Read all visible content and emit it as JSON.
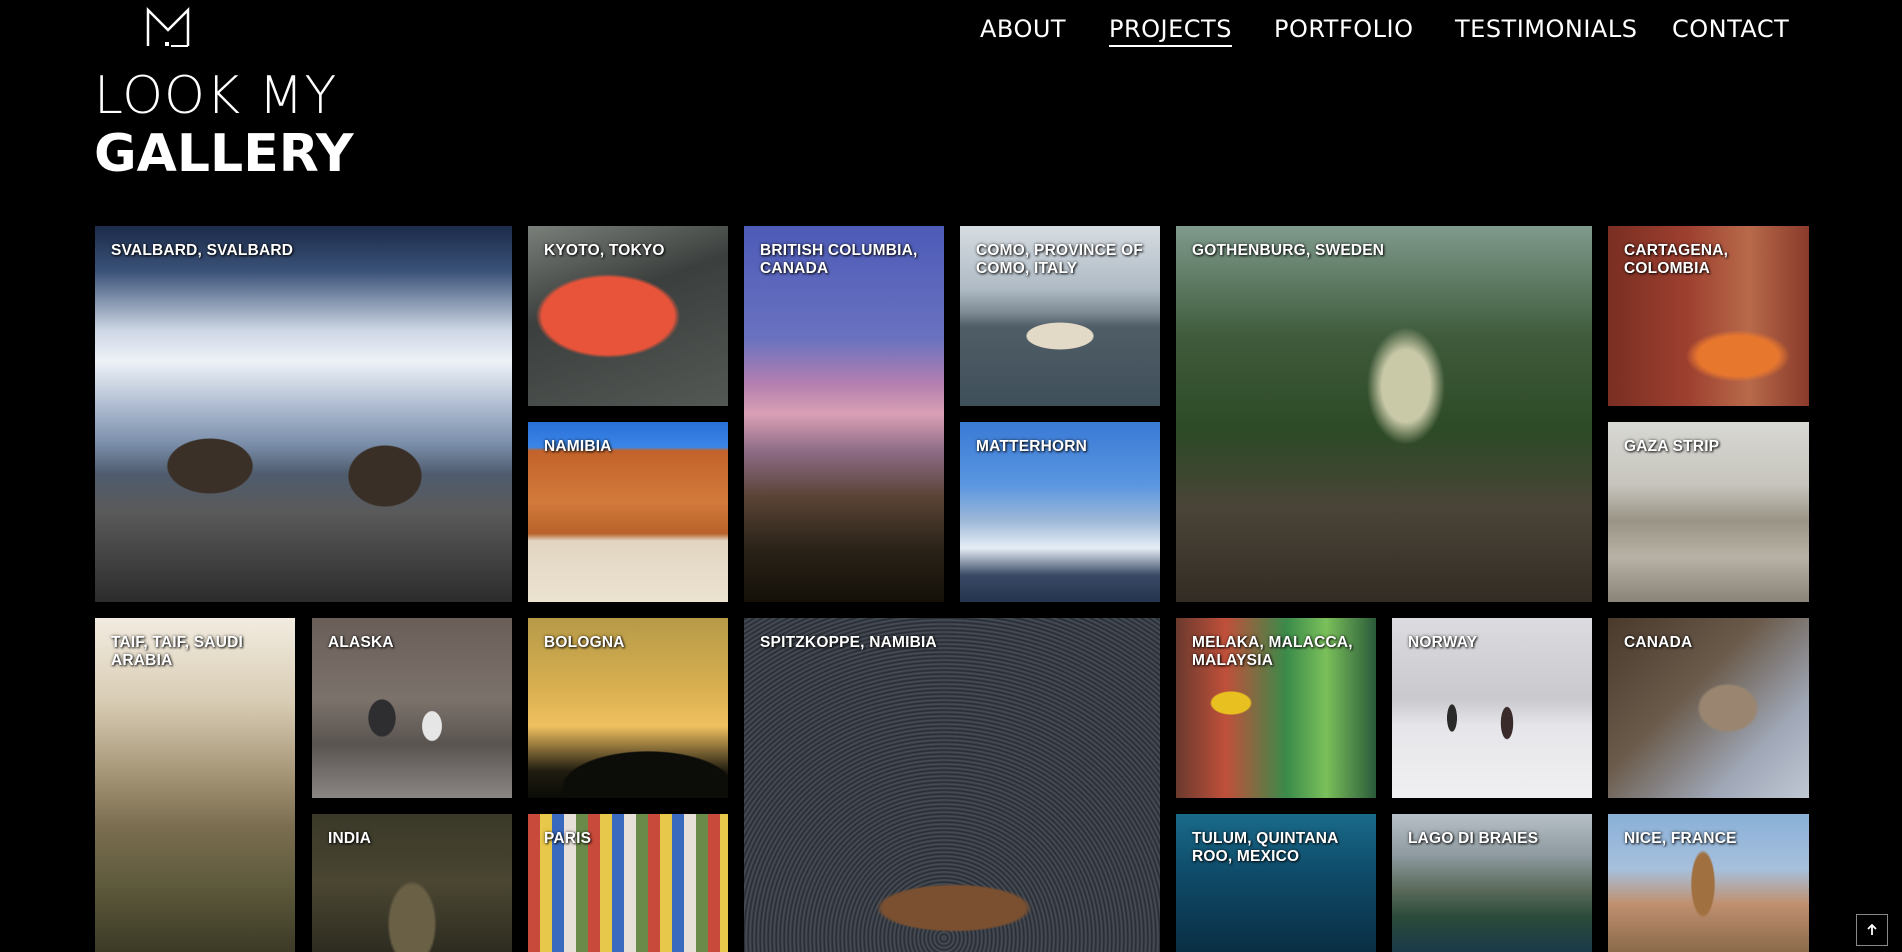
{
  "header": {
    "logo_icon": "monogram-m-logo-icon",
    "nav": [
      {
        "label": "ABOUT",
        "active": false
      },
      {
        "label": "PROJECTS",
        "active": true
      },
      {
        "label": "PORTFOLIO",
        "active": false
      },
      {
        "label": "TESTIMONIALS",
        "active": false
      },
      {
        "label": "CONTACT",
        "active": false
      }
    ]
  },
  "hero": {
    "line1": "LOOK MY",
    "line2": "GALLERY"
  },
  "gallery": {
    "tiles": [
      {
        "label": "SVALBARD, SVALBARD"
      },
      {
        "label": "KYOTO, TOKYO"
      },
      {
        "label": "BRITISH COLUMBIA, CANADA"
      },
      {
        "label": "COMO, PROVINCE OF COMO, ITALY"
      },
      {
        "label": "GOTHENBURG, SWEDEN"
      },
      {
        "label": "CARTAGENA, COLOMBIA"
      },
      {
        "label": "NAMIBIA"
      },
      {
        "label": "MATTERHORN"
      },
      {
        "label": "GAZA STRIP"
      },
      {
        "label": "TAIF, TAIF, SAUDI ARABIA"
      },
      {
        "label": "ALASKA"
      },
      {
        "label": "BOLOGNA"
      },
      {
        "label": "SPITZKOPPE, NAMIBIA"
      },
      {
        "label": "MELAKA, MALACCA, MALAYSIA"
      },
      {
        "label": "NORWAY"
      },
      {
        "label": "CANADA"
      },
      {
        "label": "INDIA"
      },
      {
        "label": "PARIS"
      },
      {
        "label": "TULUM, QUINTANA ROO, MEXICO"
      },
      {
        "label": "LAGO DI BRAIES"
      },
      {
        "label": "NICE, FRANCE"
      }
    ]
  },
  "scroll_top": {
    "icon": "arrow-up-icon"
  },
  "colors": {
    "background": "#000000",
    "text": "#ffffff"
  }
}
